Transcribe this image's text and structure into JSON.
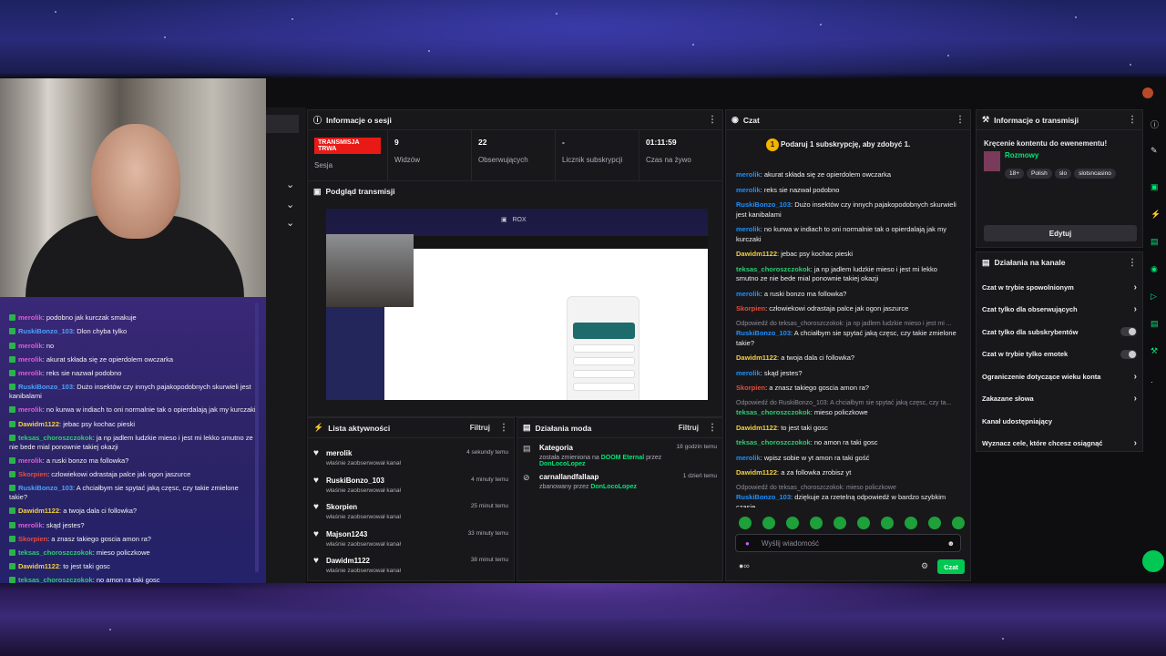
{
  "session": {
    "title": "Informacje o sesji",
    "badge": "TRANSMISJA TRWA",
    "badge_label": "Sesja",
    "stats": [
      {
        "value": "9",
        "label": "Widzów"
      },
      {
        "value": "22",
        "label": "Obserwujących"
      },
      {
        "value": "-",
        "label": "Licznik subskrypcji"
      },
      {
        "value": "01:11:59",
        "label": "Czas na żywo"
      }
    ]
  },
  "preview": {
    "title": "Podgląd transmisji",
    "overlay": "ROX"
  },
  "activity": {
    "title": "Lista aktywności",
    "filter": "Filtruj",
    "items": [
      {
        "name": "merolik",
        "sub": "właśnie zaobserwował kanał",
        "time": "4 sekundy temu"
      },
      {
        "name": "RuskiBonzo_103",
        "sub": "właśnie zaobserwował kanał",
        "time": "4 minuty temu"
      },
      {
        "name": "Skorpien",
        "sub": "właśnie zaobserwował kanał",
        "time": "25 minut temu"
      },
      {
        "name": "Majson1243",
        "sub": "właśnie zaobserwował kanał",
        "time": "33 minuty temu"
      },
      {
        "name": "Dawidm1122",
        "sub": "właśnie zaobserwował kanał",
        "time": "38 minut temu"
      }
    ]
  },
  "mod": {
    "title": "Działania moda",
    "filter": "Filtruj",
    "items": [
      {
        "name": "Kategoria",
        "pre": "została zmieniona na ",
        "target": "DOOM Eternal",
        "mid": " przez ",
        "by": "DonLocoLopez",
        "time": "18 godzin temu"
      },
      {
        "name": "carnallandfallaap",
        "pre": "zbanowany przez ",
        "target": "",
        "mid": "",
        "by": "DonLocoLopez",
        "time": "1 dzień temu"
      }
    ]
  },
  "chat": {
    "title": "Czat",
    "sub_note": "Podaruj 1 subskrypcję, aby zdobyć 1.",
    "sub_coin": "1",
    "messages": [
      {
        "user": "merolik",
        "color": "#1e90ff",
        "text": ": akurat składa się ze opierdolem owczarka",
        "reply": ""
      },
      {
        "user": "merolik",
        "color": "#1e90ff",
        "text": ": reks sie nazwał podobno",
        "reply": ""
      },
      {
        "user": "RuskiBonzo_103",
        "color": "#1e90ff",
        "text": ": Dużo insektów czy innych pajakopodobnych skurwieli jest kanibalami",
        "reply": ""
      },
      {
        "user": "merolik",
        "color": "#1e90ff",
        "text": ": no kurwa w indiach to oni normalnie tak o opierdalają jak my kurczaki",
        "reply": ""
      },
      {
        "user": "Dawidm1122",
        "color": "#f4d03f",
        "text": ": jebac psy kochac pieski",
        "reply": ""
      },
      {
        "user": "teksas_choroszczokok",
        "color": "#2ecc71",
        "text": ": ja np jadlem ludzkie mieso i jest mi lekko smutno ze nie bede mial ponownie takiej okazji",
        "reply": ""
      },
      {
        "user": "merolik",
        "color": "#1e90ff",
        "text": ": a ruski bonzo ma followka?",
        "reply": ""
      },
      {
        "user": "Skorpien",
        "color": "#e74c3c",
        "text": ": człowiekowi odrastaja palce jak ogon jaszurce",
        "reply": ""
      },
      {
        "user": "RuskiBonzo_103",
        "color": "#1e90ff",
        "text": ": A chciałbym sie spytać jaką częsc, czy takie zmielone takie?",
        "reply": "Odpowiedź do teksas_choroszczokok: ja np jadlem ludzkie mieso i jest mi ..."
      },
      {
        "user": "Dawidm1122",
        "color": "#f4d03f",
        "text": ": a twoja dala ci followka?",
        "reply": ""
      },
      {
        "user": "merolik",
        "color": "#1e90ff",
        "text": ": skąd jestes?",
        "reply": ""
      },
      {
        "user": "Skorpien",
        "color": "#e74c3c",
        "text": ": a znasz takiego goscia amon ra?",
        "reply": ""
      },
      {
        "user": "teksas_choroszczokok",
        "color": "#2ecc71",
        "text": ": mieso policzkowe",
        "reply": "Odpowiedź do RuskiBonzo_103: A chciałbym sie spytać jaką częsc, czy ta..."
      },
      {
        "user": "Dawidm1122",
        "color": "#f4d03f",
        "text": ": to jest taki gosc",
        "reply": ""
      },
      {
        "user": "teksas_choroszczokok",
        "color": "#2ecc71",
        "text": ": no amon ra taki gosc",
        "reply": ""
      },
      {
        "user": "merolik",
        "color": "#1e90ff",
        "text": ": wpisz sobie w yt amon ra taki gość",
        "reply": ""
      },
      {
        "user": "Dawidm1122",
        "color": "#f4d03f",
        "text": ": a za followka zrobisz yt",
        "reply": ""
      },
      {
        "user": "RuskiBonzo_103",
        "color": "#1e90ff",
        "text": ": dziękuje za rzetelną odpowiedź w bardzo szybkim czasie",
        "reply": "Odpowiedź do teksas_choroszczokok: mieso policzkowe"
      }
    ],
    "input_placeholder": "Wyślij wiadomość",
    "send_label": "Czat"
  },
  "stream_info": {
    "title": "Informacje o transmisji",
    "stream_title": "Kręcenie kontentu do ewenementu!",
    "category": "Rozmowy",
    "tags": [
      "18+",
      "Polish",
      "slo",
      "slotsncasino"
    ],
    "edit_label": "Edytuj"
  },
  "channel_actions": {
    "title": "Działania na kanale",
    "items": [
      {
        "label": "Czat w trybie spowolnionym",
        "kind": "arrow"
      },
      {
        "label": "Czat tylko dla obserwujących",
        "kind": "arrow"
      },
      {
        "label": "Czat tylko dla subskrybentów",
        "kind": "toggle"
      },
      {
        "label": "Czat w trybie tylko emotek",
        "kind": "toggle"
      },
      {
        "label": "Ograniczenie dotyczące wieku konta",
        "kind": "arrow"
      },
      {
        "label": "Zakazane słowa",
        "kind": "arrow"
      },
      {
        "label": "Kanał udostępniający",
        "kind": "none"
      },
      {
        "label": "Wyznacz cele, które chcesz osiągnąć",
        "kind": "arrow"
      }
    ]
  },
  "overlay_chat": {
    "messages": [
      {
        "user": "merolik",
        "color": "#e05bd6",
        "text": ": podobno jak kurczak smakuje"
      },
      {
        "user": "RuskiBonzo_103",
        "color": "#4aa3ff",
        "text": ": Dlon chyba tylko"
      },
      {
        "user": "merolik",
        "color": "#e05bd6",
        "text": ": no"
      },
      {
        "user": "merolik",
        "color": "#e05bd6",
        "text": ": akurat składa się ze opierdolem owczarka"
      },
      {
        "user": "merolik",
        "color": "#e05bd6",
        "text": ": reks sie nazwał podobno"
      },
      {
        "user": "RuskiBonzo_103",
        "color": "#4aa3ff",
        "text": ": Dużo insektów czy innych pajakopodobnych skurwieli jest kanibalami"
      },
      {
        "user": "merolik",
        "color": "#e05bd6",
        "text": ": no kurwa w indiach to oni normalnie tak o opierdalają jak my kurczaki"
      },
      {
        "user": "Dawidm1122",
        "color": "#f4d03f",
        "text": ": jebac psy kochac pieski"
      },
      {
        "user": "teksas_choroszczokok",
        "color": "#2ecc71",
        "text": ": ja np jadlem ludzkie mieso i jest mi lekko smutno ze nie bede mial ponownie takiej okazji"
      },
      {
        "user": "merolik",
        "color": "#e05bd6",
        "text": ": a ruski bonzo ma followka?"
      },
      {
        "user": "Skorpien",
        "color": "#e74c3c",
        "text": ": czlowiekowi odrastaja palce jak ogon jaszurce"
      },
      {
        "user": "RuskiBonzo_103",
        "color": "#4aa3ff",
        "text": ": A chciałbym sie spytać jaką częsc, czy takie zmielone takie?"
      },
      {
        "user": "Dawidm1122",
        "color": "#f4d03f",
        "text": ": a twoja dala ci followka?"
      },
      {
        "user": "merolik",
        "color": "#e05bd6",
        "text": ": skąd jestes?"
      },
      {
        "user": "Skorpien",
        "color": "#e74c3c",
        "text": ": a znasz takiego goscia amon ra?"
      },
      {
        "user": "teksas_choroszczokok",
        "color": "#2ecc71",
        "text": ": mieso policzkowe"
      },
      {
        "user": "Dawidm1122",
        "color": "#f4d03f",
        "text": ": to jest taki gosc"
      },
      {
        "user": "teksas_choroszczokok",
        "color": "#2ecc71",
        "text": ": no amon ra taki gosc"
      }
    ]
  }
}
